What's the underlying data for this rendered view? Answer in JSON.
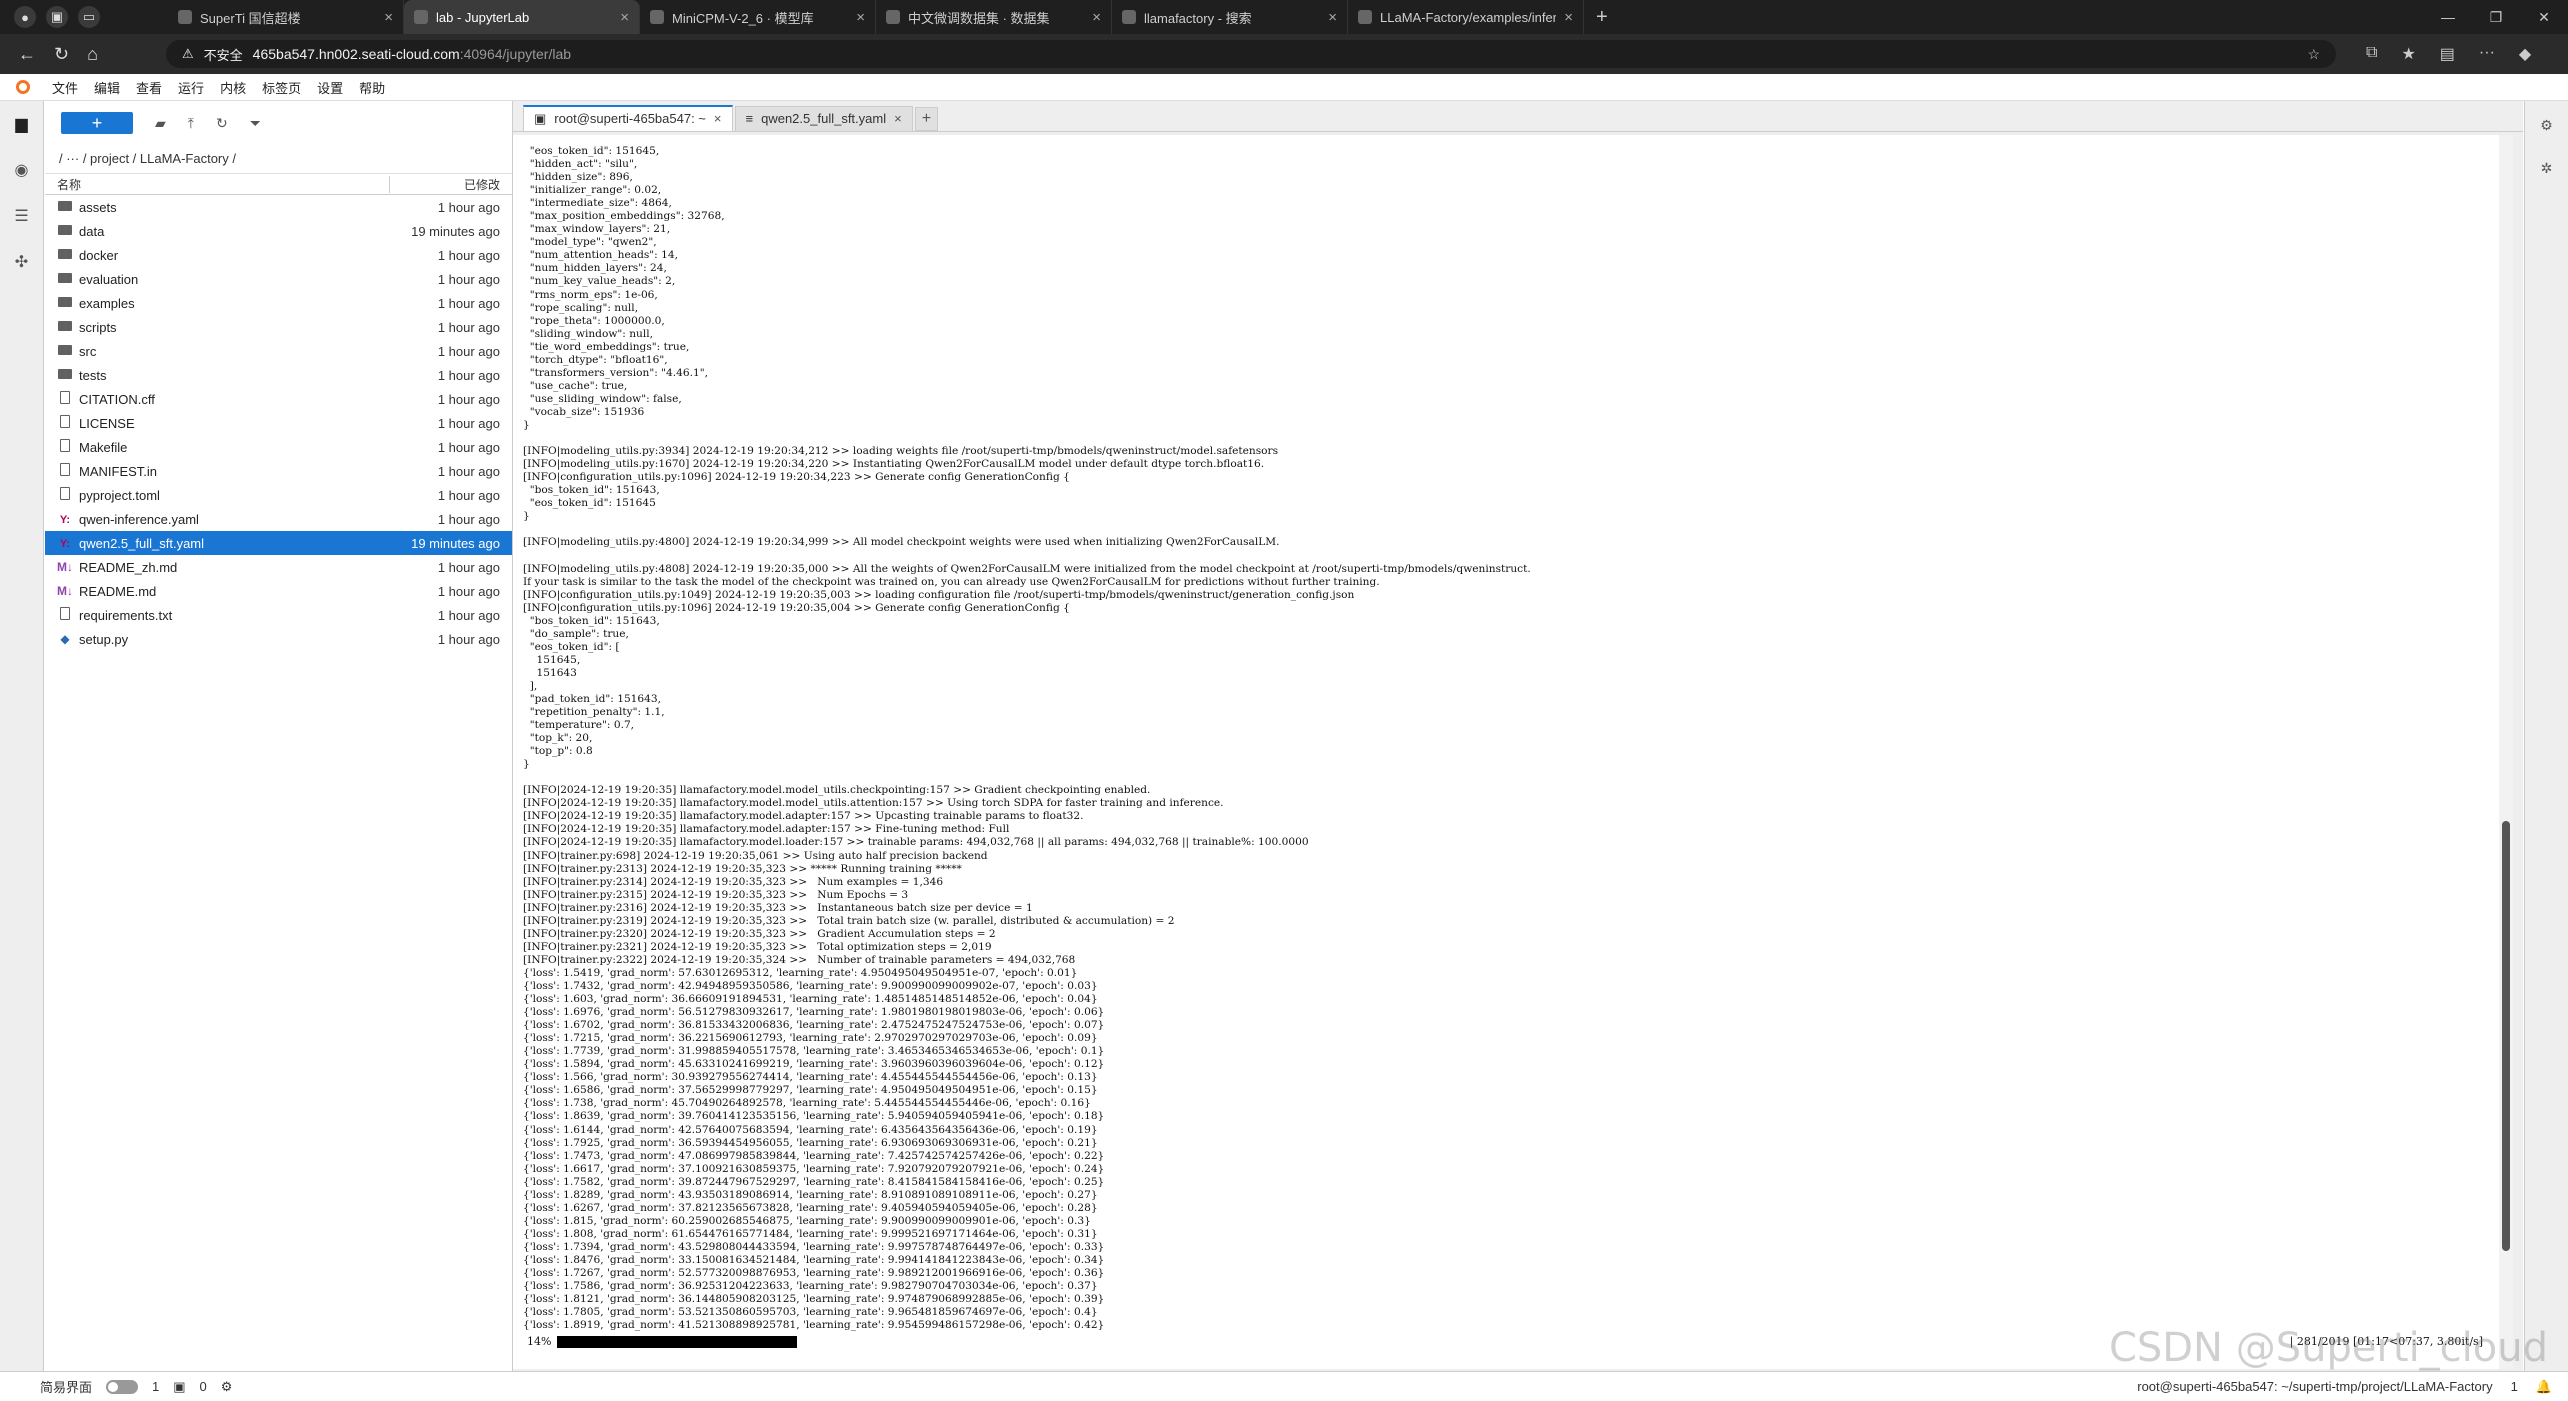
{
  "browser": {
    "tabs": [
      {
        "title": "SuperTi 国信超楼",
        "active": false
      },
      {
        "title": "lab - JupyterLab",
        "active": true
      },
      {
        "title": "MiniCPM-V-2_6 · 模型库",
        "active": false
      },
      {
        "title": "中文微调数据集 · 数据集",
        "active": false
      },
      {
        "title": "llamafactory - 搜索",
        "active": false
      },
      {
        "title": "LLaMA-Factory/examples/inferen",
        "active": false
      }
    ],
    "security_label": "不安全",
    "url_host": "465ba547.hn002.seati-cloud.com",
    "url_rest": ":40964/jupyter/lab"
  },
  "menu": [
    "文件",
    "编辑",
    "查看",
    "运行",
    "内核",
    "标签页",
    "设置",
    "帮助"
  ],
  "filebrowser": {
    "breadcrumb": "/   ···   / project / LLaMA-Factory /",
    "col_name": "名称",
    "col_modified": "已修改",
    "files": [
      {
        "name": "assets",
        "type": "folder",
        "time": "1 hour ago"
      },
      {
        "name": "data",
        "type": "folder",
        "time": "19 minutes ago"
      },
      {
        "name": "docker",
        "type": "folder",
        "time": "1 hour ago"
      },
      {
        "name": "evaluation",
        "type": "folder",
        "time": "1 hour ago"
      },
      {
        "name": "examples",
        "type": "folder",
        "time": "1 hour ago"
      },
      {
        "name": "scripts",
        "type": "folder",
        "time": "1 hour ago"
      },
      {
        "name": "src",
        "type": "folder",
        "time": "1 hour ago"
      },
      {
        "name": "tests",
        "type": "folder",
        "time": "1 hour ago"
      },
      {
        "name": "CITATION.cff",
        "type": "file",
        "time": "1 hour ago"
      },
      {
        "name": "LICENSE",
        "type": "file",
        "time": "1 hour ago"
      },
      {
        "name": "Makefile",
        "type": "file",
        "time": "1 hour ago"
      },
      {
        "name": "MANIFEST.in",
        "type": "file",
        "time": "1 hour ago"
      },
      {
        "name": "pyproject.toml",
        "type": "file",
        "time": "1 hour ago"
      },
      {
        "name": "qwen-inference.yaml",
        "type": "yaml",
        "time": "1 hour ago"
      },
      {
        "name": "qwen2.5_full_sft.yaml",
        "type": "yaml",
        "time": "19 minutes ago",
        "selected": true
      },
      {
        "name": "README_zh.md",
        "type": "md",
        "time": "1 hour ago"
      },
      {
        "name": "README.md",
        "type": "md",
        "time": "1 hour ago"
      },
      {
        "name": "requirements.txt",
        "type": "file",
        "time": "1 hour ago"
      },
      {
        "name": "setup.py",
        "type": "py",
        "time": "1 hour ago"
      }
    ]
  },
  "editor_tabs": [
    {
      "label": "root@superti-465ba547: ~",
      "active": true
    },
    {
      "label": "qwen2.5_full_sft.yaml",
      "active": false
    }
  ],
  "terminal": {
    "lines": [
      "  \"eos_token_id\": 151645,",
      "  \"hidden_act\": \"silu\",",
      "  \"hidden_size\": 896,",
      "  \"initializer_range\": 0.02,",
      "  \"intermediate_size\": 4864,",
      "  \"max_position_embeddings\": 32768,",
      "  \"max_window_layers\": 21,",
      "  \"model_type\": \"qwen2\",",
      "  \"num_attention_heads\": 14,",
      "  \"num_hidden_layers\": 24,",
      "  \"num_key_value_heads\": 2,",
      "  \"rms_norm_eps\": 1e-06,",
      "  \"rope_scaling\": null,",
      "  \"rope_theta\": 1000000.0,",
      "  \"sliding_window\": null,",
      "  \"tie_word_embeddings\": true,",
      "  \"torch_dtype\": \"bfloat16\",",
      "  \"transformers_version\": \"4.46.1\",",
      "  \"use_cache\": true,",
      "  \"use_sliding_window\": false,",
      "  \"vocab_size\": 151936",
      "}",
      "",
      "[INFO|modeling_utils.py:3934] 2024-12-19 19:20:34,212 >> loading weights file /root/superti-tmp/bmodels/qweninstruct/model.safetensors",
      "[INFO|modeling_utils.py:1670] 2024-12-19 19:20:34,220 >> Instantiating Qwen2ForCausalLM model under default dtype torch.bfloat16.",
      "[INFO|configuration_utils.py:1096] 2024-12-19 19:20:34,223 >> Generate config GenerationConfig {",
      "  \"bos_token_id\": 151643,",
      "  \"eos_token_id\": 151645",
      "}",
      "",
      "[INFO|modeling_utils.py:4800] 2024-12-19 19:20:34,999 >> All model checkpoint weights were used when initializing Qwen2ForCausalLM.",
      "",
      "[INFO|modeling_utils.py:4808] 2024-12-19 19:20:35,000 >> All the weights of Qwen2ForCausalLM were initialized from the model checkpoint at /root/superti-tmp/bmodels/qweninstruct.",
      "If your task is similar to the task the model of the checkpoint was trained on, you can already use Qwen2ForCausalLM for predictions without further training.",
      "[INFO|configuration_utils.py:1049] 2024-12-19 19:20:35,003 >> loading configuration file /root/superti-tmp/bmodels/qweninstruct/generation_config.json",
      "[INFO|configuration_utils.py:1096] 2024-12-19 19:20:35,004 >> Generate config GenerationConfig {",
      "  \"bos_token_id\": 151643,",
      "  \"do_sample\": true,",
      "  \"eos_token_id\": [",
      "    151645,",
      "    151643",
      "  ],",
      "  \"pad_token_id\": 151643,",
      "  \"repetition_penalty\": 1.1,",
      "  \"temperature\": 0.7,",
      "  \"top_k\": 20,",
      "  \"top_p\": 0.8",
      "}",
      "",
      "[INFO|2024-12-19 19:20:35] llamafactory.model.model_utils.checkpointing:157 >> Gradient checkpointing enabled.",
      "[INFO|2024-12-19 19:20:35] llamafactory.model.model_utils.attention:157 >> Using torch SDPA for faster training and inference.",
      "[INFO|2024-12-19 19:20:35] llamafactory.model.adapter:157 >> Upcasting trainable params to float32.",
      "[INFO|2024-12-19 19:20:35] llamafactory.model.adapter:157 >> Fine-tuning method: Full",
      "[INFO|2024-12-19 19:20:35] llamafactory.model.loader:157 >> trainable params: 494,032,768 || all params: 494,032,768 || trainable%: 100.0000",
      "[INFO|trainer.py:698] 2024-12-19 19:20:35,061 >> Using auto half precision backend",
      "[INFO|trainer.py:2313] 2024-12-19 19:20:35,323 >> ***** Running training *****",
      "[INFO|trainer.py:2314] 2024-12-19 19:20:35,323 >>   Num examples = 1,346",
      "[INFO|trainer.py:2315] 2024-12-19 19:20:35,323 >>   Num Epochs = 3",
      "[INFO|trainer.py:2316] 2024-12-19 19:20:35,323 >>   Instantaneous batch size per device = 1",
      "[INFO|trainer.py:2319] 2024-12-19 19:20:35,323 >>   Total train batch size (w. parallel, distributed & accumulation) = 2",
      "[INFO|trainer.py:2320] 2024-12-19 19:20:35,323 >>   Gradient Accumulation steps = 2",
      "[INFO|trainer.py:2321] 2024-12-19 19:20:35,323 >>   Total optimization steps = 2,019",
      "[INFO|trainer.py:2322] 2024-12-19 19:20:35,324 >>   Number of trainable parameters = 494,032,768",
      "{'loss': 1.5419, 'grad_norm': 57.63012695312, 'learning_rate': 4.950495049504951e-07, 'epoch': 0.01}",
      "{'loss': 1.7432, 'grad_norm': 42.94948959350586, 'learning_rate': 9.900990099009902e-07, 'epoch': 0.03}",
      "{'loss': 1.603, 'grad_norm': 36.66609191894531, 'learning_rate': 1.4851485148514852e-06, 'epoch': 0.04}",
      "{'loss': 1.6976, 'grad_norm': 56.51279830932617, 'learning_rate': 1.9801980198019803e-06, 'epoch': 0.06}",
      "{'loss': 1.6702, 'grad_norm': 36.81533432006836, 'learning_rate': 2.4752475247524753e-06, 'epoch': 0.07}",
      "{'loss': 1.7215, 'grad_norm': 36.2215690612793, 'learning_rate': 2.9702970297029703e-06, 'epoch': 0.09}",
      "{'loss': 1.7739, 'grad_norm': 31.998859405517578, 'learning_rate': 3.4653465346534653e-06, 'epoch': 0.1}",
      "{'loss': 1.5894, 'grad_norm': 45.63310241699219, 'learning_rate': 3.9603960396039604e-06, 'epoch': 0.12}",
      "{'loss': 1.566, 'grad_norm': 30.939279556274414, 'learning_rate': 4.455445544554456e-06, 'epoch': 0.13}",
      "{'loss': 1.6586, 'grad_norm': 37.56529998779297, 'learning_rate': 4.950495049504951e-06, 'epoch': 0.15}",
      "{'loss': 1.738, 'grad_norm': 45.70490264892578, 'learning_rate': 5.445544554455446e-06, 'epoch': 0.16}",
      "{'loss': 1.8639, 'grad_norm': 39.760414123535156, 'learning_rate': 5.940594059405941e-06, 'epoch': 0.18}",
      "{'loss': 1.6144, 'grad_norm': 42.57640075683594, 'learning_rate': 6.435643564356436e-06, 'epoch': 0.19}",
      "{'loss': 1.7925, 'grad_norm': 36.59394454956055, 'learning_rate': 6.930693069306931e-06, 'epoch': 0.21}",
      "{'loss': 1.7473, 'grad_norm': 47.086997985839844, 'learning_rate': 7.425742574257426e-06, 'epoch': 0.22}",
      "{'loss': 1.6617, 'grad_norm': 37.100921630859375, 'learning_rate': 7.920792079207921e-06, 'epoch': 0.24}",
      "{'loss': 1.7582, 'grad_norm': 39.872447967529297, 'learning_rate': 8.415841584158416e-06, 'epoch': 0.25}",
      "{'loss': 1.8289, 'grad_norm': 43.93503189086914, 'learning_rate': 8.910891089108911e-06, 'epoch': 0.27}",
      "{'loss': 1.6267, 'grad_norm': 37.82123565673828, 'learning_rate': 9.405940594059405e-06, 'epoch': 0.28}",
      "{'loss': 1.815, 'grad_norm': 60.259002685546875, 'learning_rate': 9.900990099009901e-06, 'epoch': 0.3}",
      "{'loss': 1.808, 'grad_norm': 61.654476165771484, 'learning_rate': 9.999521697171464e-06, 'epoch': 0.31}",
      "{'loss': 1.7394, 'grad_norm': 43.529808044433594, 'learning_rate': 9.997578748764497e-06, 'epoch': 0.33}",
      "{'loss': 1.8476, 'grad_norm': 33.150081634521484, 'learning_rate': 9.994141841223843e-06, 'epoch': 0.34}",
      "{'loss': 1.7267, 'grad_norm': 52.577320098876953, 'learning_rate': 9.989212001966916e-06, 'epoch': 0.36}",
      "{'loss': 1.7586, 'grad_norm': 36.92531204223633, 'learning_rate': 9.982790704703034e-06, 'epoch': 0.37}",
      "{'loss': 1.8121, 'grad_norm': 36.144805908203125, 'learning_rate': 9.974879068992885e-06, 'epoch': 0.39}",
      "{'loss': 1.7805, 'grad_norm': 53.521350860595703, 'learning_rate': 9.965481859674697e-06, 'epoch': 0.4}",
      "{'loss': 1.8919, 'grad_norm': 41.521308898925781, 'learning_rate': 9.954599486157298e-06, 'epoch': 0.42}"
    ],
    "progress_pct": "14%",
    "progress_stats": "| 281/2019 [01:17<07:37,  3.80it/s]"
  },
  "statusbar": {
    "mode_label": "简易界面",
    "count1": "1",
    "count2": "0",
    "terminal_label": "root@superti-465ba547: ~/superti-tmp/project/LLaMA-Factory",
    "line": "1"
  },
  "watermark": "CSDN @Superti_cloud"
}
